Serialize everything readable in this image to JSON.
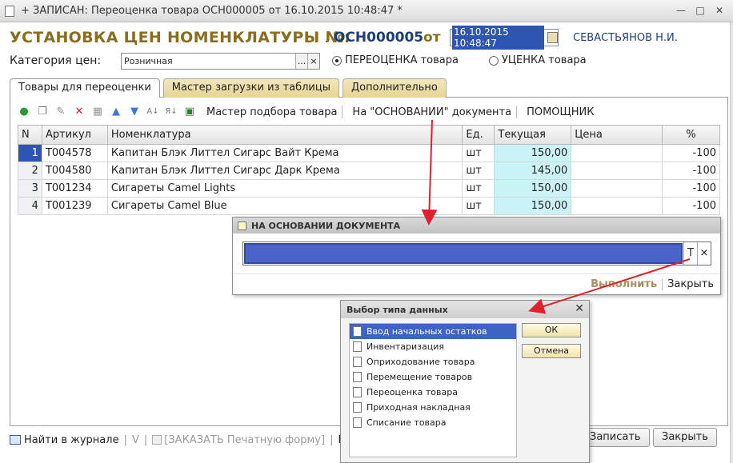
{
  "window": {
    "title": "+ ЗАПИСАН: Переоценка товара ОСН000005 от 16.10.2015 10:48:47 *",
    "minimize": "—",
    "maximize": "□",
    "close": "✕"
  },
  "header": {
    "title": "УСТАНОВКА ЦЕН НОМЕНКЛАТУРЫ №:",
    "number": "ОСН000005",
    "ot": "от",
    "date": "16.10.2015 10:48:47",
    "author": "СЕВАСТЬЯНОВ Н.И."
  },
  "category": {
    "label": "Категория цен:",
    "value": "Розничная",
    "select_btn": "...",
    "clear_btn": "×"
  },
  "radio": {
    "option1": "ПЕРЕОЦЕНКА товара",
    "option2": "УЦЕНКА товара"
  },
  "tabs": [
    {
      "label": "Товары для переоценки"
    },
    {
      "label": "Мастер загрузки из таблицы"
    },
    {
      "label": "Дополнительно"
    }
  ],
  "toolbar": {
    "master": "Мастер подбора товара",
    "based_on": "На \"ОСНОВАНИИ\" документа",
    "helper": "ПОМОЩНИК"
  },
  "table": {
    "headers": [
      "N",
      "Артикул",
      "Номенклатура",
      "Ед.",
      "Текущая",
      "Цена",
      "%"
    ],
    "rows": [
      {
        "n": "1",
        "article": "Т004578",
        "name": "Капитан Блэк Литтел Сигарс Вайт Крема",
        "unit": "шт",
        "current": "150,00",
        "price": "",
        "pct": "-100"
      },
      {
        "n": "2",
        "article": "Т004580",
        "name": "Капитан Блэк Литтел Сигарс Дарк Крема",
        "unit": "шт",
        "current": "145,00",
        "price": "",
        "pct": "-100"
      },
      {
        "n": "3",
        "article": "Т001234",
        "name": "Сигареты Camel Lights",
        "unit": "шт",
        "current": "150,00",
        "price": "",
        "pct": "-100"
      },
      {
        "n": "4",
        "article": "Т001239",
        "name": "Сигареты Camel Blue",
        "unit": "шт",
        "current": "150,00",
        "price": "",
        "pct": "-100"
      }
    ]
  },
  "dialog_basis": {
    "title": "НА ОСНОВАНИИ ДОКУМЕНТА",
    "type_btn": "T",
    "clear_btn": "×",
    "execute": "Выполнить",
    "close": "Закрыть"
  },
  "dialog_type": {
    "title": "Выбор типа данных",
    "close": "✕",
    "items": [
      "Ввод начальных остатков",
      "Инвентаризация",
      "Оприходование товара",
      "Перемещение товаров",
      "Переоценка товара",
      "Приходная накладная",
      "Списание товара"
    ],
    "ok": "ОК",
    "cancel": "Отмена"
  },
  "bottom": {
    "journal": "Найти в журнале",
    "v": "V",
    "order": "[ЗАКАЗАТЬ Печатную форму]",
    "pe": "Пе",
    "save": "Записать",
    "close": "Закрыть"
  },
  "colors": {
    "accent_title": "#8a6d1d",
    "doc_number": "#1c3f7a",
    "selection": "#2f55b3",
    "current_price_bg": "#c9f3f7",
    "arrow": "#e0202a"
  }
}
